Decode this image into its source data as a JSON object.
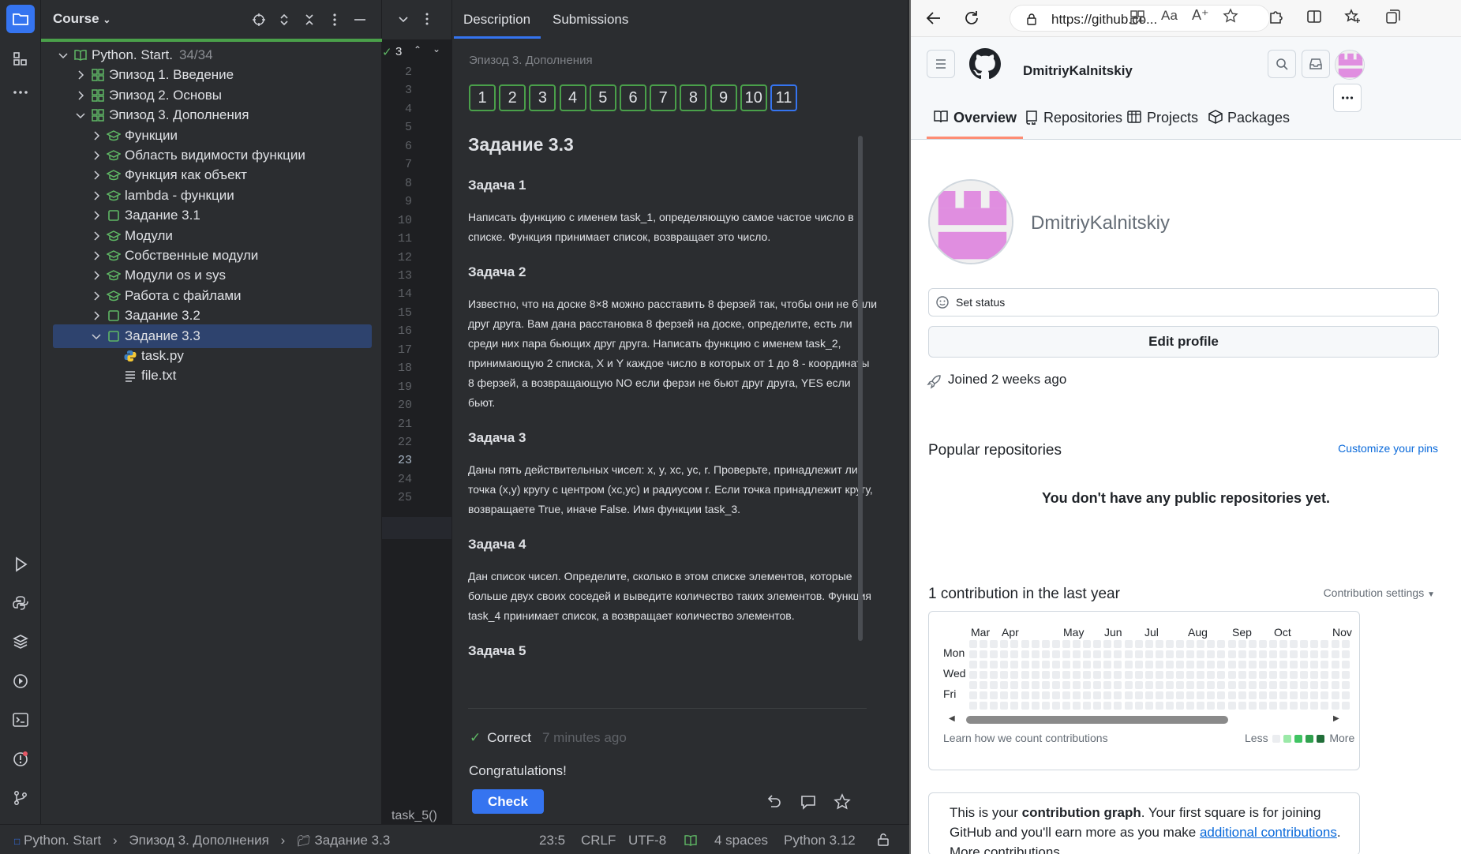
{
  "ide": {
    "project_panel": {
      "title": "Course",
      "tree": [
        {
          "label": "Python. Start.",
          "count": "34/34",
          "depth": 0,
          "icon": "course-book-icon",
          "expanded": true
        },
        {
          "label": "Эпизод 1. Введение",
          "depth": 1,
          "icon": "section-grid-icon",
          "expanded": false
        },
        {
          "label": "Эпизод 2. Основы",
          "depth": 1,
          "icon": "section-grid-icon",
          "expanded": false
        },
        {
          "label": "Эпизод 3. Дополнения",
          "depth": 1,
          "icon": "section-grid-icon",
          "expanded": true
        },
        {
          "label": "Функции",
          "depth": 2,
          "icon": "lesson-cap-icon",
          "expanded": false
        },
        {
          "label": "Область видимости функции",
          "depth": 2,
          "icon": "lesson-cap-icon",
          "expanded": false
        },
        {
          "label": "Функция как объект",
          "depth": 2,
          "icon": "lesson-cap-icon",
          "expanded": false
        },
        {
          "label": "lambda - функции",
          "depth": 2,
          "icon": "lesson-cap-icon",
          "expanded": false
        },
        {
          "label": "Задание 3.1",
          "depth": 2,
          "icon": "task-square-icon",
          "expanded": false
        },
        {
          "label": "Модули",
          "depth": 2,
          "icon": "lesson-cap-icon",
          "expanded": false
        },
        {
          "label": "Собственные модули",
          "depth": 2,
          "icon": "lesson-cap-icon",
          "expanded": false
        },
        {
          "label": "Модули os и sys",
          "depth": 2,
          "icon": "lesson-cap-icon",
          "expanded": false
        },
        {
          "label": "Работа с файлами",
          "depth": 2,
          "icon": "lesson-cap-icon",
          "expanded": false
        },
        {
          "label": "Задание 3.2",
          "depth": 2,
          "icon": "task-square-icon",
          "expanded": false
        },
        {
          "label": "Задание 3.3",
          "depth": 2,
          "icon": "task-square-icon",
          "expanded": true,
          "selected": true
        },
        {
          "label": "task.py",
          "depth": 3,
          "icon": "python-file-icon"
        },
        {
          "label": "file.txt",
          "depth": 3,
          "icon": "text-file-icon"
        }
      ]
    },
    "editor": {
      "problems_count": "3",
      "line_numbers": [
        "2",
        "3",
        "4",
        "5",
        "6",
        "7",
        "8",
        "9",
        "10",
        "11",
        "12",
        "13",
        "14",
        "15",
        "16",
        "17",
        "18",
        "19",
        "20",
        "21",
        "22",
        "23",
        "24",
        "25"
      ],
      "current_line": "23",
      "function_crumb": "task_5()"
    },
    "description": {
      "tabs": [
        "Description",
        "Submissions"
      ],
      "subtitle": "Эпизод 3. Дополнения",
      "task_numbers": [
        "1",
        "2",
        "3",
        "4",
        "5",
        "6",
        "7",
        "8",
        "9",
        "10",
        "11"
      ],
      "current_task": "11",
      "heading": "Задание 3.3",
      "tasks": [
        {
          "title": "Задача 1",
          "text": "Написать функцию с именем task_1, определяющую самое частое число в списке. Функция принимает список, возвращает это число."
        },
        {
          "title": "Задача 2",
          "text": "Известно, что на доске 8×8 можно расставить 8 ферзей так, чтобы они не били друг друга. Вам дана расстановка 8 ферзей на доске, определите, есть ли среди них пара бьющих друг друга. Написать функцию с именем task_2, принимающую 2 списка, X и Y каждое число в которых от 1 до 8 - координаты 8 ферзей, а возвращающую NO если ферзи не бьют друг друга, YES если бьют."
        },
        {
          "title": "Задача 3",
          "text": "Даны пять действительных чисел: x, y, xc, yc, r. Проверьте, принадлежит ли точка (x,y) кругу с центром (xc,yc) и радиусом r. Если точка принадлежит кругу, возвращаете True, иначе False. Имя функции task_3."
        },
        {
          "title": "Задача 4",
          "text": "Дан список чисел. Определите, сколько в этом списке элементов, которые больше двух своих соседей и выведите количество таких элементов. Функция task_4 принимает список, а возвращает количество элементов."
        },
        {
          "title": "Задача 5",
          "text": ""
        }
      ],
      "result_label": "Correct",
      "result_time": "7 minutes ago",
      "congrats": "Congratulations!",
      "check_button": "Check"
    },
    "status_bar": {
      "breadcrumb": [
        "Python. Start",
        "Эпизод 3. Дополнения",
        "Задание 3.3"
      ],
      "position": "23:5",
      "line_ending": "CRLF",
      "encoding": "UTF-8",
      "indent": "4 spaces",
      "interpreter": "Python 3.12"
    }
  },
  "browser": {
    "url": "https://github.co...",
    "github": {
      "username": "DmitriyKalnitskiy",
      "tabs": [
        "Overview",
        "Repositories",
        "Projects",
        "Packages"
      ],
      "display_name": "DmitriyKalnitskiy",
      "set_status": "Set status",
      "edit_profile": "Edit profile",
      "joined": "Joined 2 weeks ago",
      "popular_title": "Popular repositories",
      "customize_pins": "Customize your pins",
      "no_repos": "You don't have any public repositories yet.",
      "contrib_title": "1 contribution in the last year",
      "contrib_settings": "Contribution settings",
      "months": [
        "Mar",
        "Apr",
        "May",
        "Jun",
        "Jul",
        "Aug",
        "Sep",
        "Oct",
        "Nov"
      ],
      "weekdays": [
        "Mon",
        "Wed",
        "Fri"
      ],
      "learn_how": "Learn how we count contributions",
      "legend_less": "Less",
      "legend_more": "More",
      "legend_colors": [
        "#ebedf0",
        "#9be9a8",
        "#40c463",
        "#30a14e",
        "#216e39"
      ],
      "graph_text_1": "This is your ",
      "graph_text_bold": "contribution graph",
      "graph_text_2": ". Your first square is for joining GitHub and you'll earn more as you make ",
      "graph_text_link": "additional contributions",
      "graph_text_3": ". More contributions"
    }
  },
  "colors": {
    "accent": "#3574f0",
    "success": "#4aa04a",
    "avatar": "#e08ee0"
  }
}
